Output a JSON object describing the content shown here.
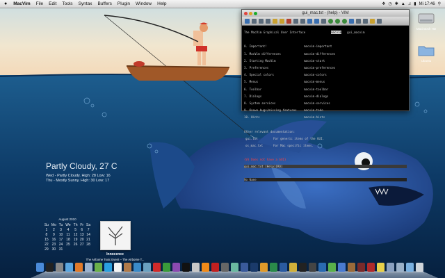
{
  "menubar": {
    "apple": "",
    "app_name": "MacVim",
    "items": [
      "File",
      "Edit",
      "Tools",
      "Syntax",
      "Buffers",
      "Plugin",
      "Window",
      "Help"
    ],
    "clock": "Mi 17:46"
  },
  "vim": {
    "title": "gui_mac.txt - (help) - VIM",
    "header_left": "The MacVim Graphical User Interface",
    "header_tag": "macvim",
    "header_right": "gui_macvim",
    "toc": [
      {
        "left": "0. Important!",
        "right": "macvim-important"
      },
      {
        "left": "1. MacVim differences",
        "right": "macvim-differences"
      },
      {
        "left": "2. Starting MacVim",
        "right": "macvim-start"
      },
      {
        "left": "3. Preferences",
        "right": "macvim-preferences"
      },
      {
        "left": "4. Special colors",
        "right": "macvim-colors"
      },
      {
        "left": "5. Menus",
        "right": "macvim-menus"
      },
      {
        "left": "6. Toolbar",
        "right": "macvim-toolbar"
      },
      {
        "left": "7. Dialogs",
        "right": "macvim-dialogs"
      },
      {
        "left": "8. System services",
        "right": "macvim-services"
      },
      {
        "left": "9. Known bugs/missing features",
        "right": "macvim-todo"
      },
      {
        "left": "10. Hints",
        "right": "macvim-hints"
      }
    ],
    "other_heading": "Other relevant documentation:",
    "docs": [
      {
        "left": "gui.txt",
        "right": "For generic items of the GUI."
      },
      {
        "left": "os_mac.txt",
        "right": "For Mac specific items."
      }
    ],
    "error_line": "{V} Does not have a GUI}",
    "status_line": "gui_mac.txt [Help][RO]",
    "status_line2": "No Name"
  },
  "desktop_icons": [
    {
      "name": "harddisk-icon",
      "label": "Macintosh HD"
    },
    {
      "name": "folder-icon",
      "label": "Ubuntu"
    }
  ],
  "weather": {
    "current": "Partly Cloudy, 27 C",
    "forecast": [
      "Wed - Partly Cloudy. High: 28 Low: 16",
      "Thu - Mostly Sunny. High: 30 Low: 17"
    ]
  },
  "calendar": {
    "month": "August 2010",
    "weekdays": [
      "Su",
      "Mo",
      "Tu",
      "We",
      "Th",
      "Fr",
      "Sa"
    ],
    "weeks": [
      [
        "1",
        "2",
        "3",
        "4",
        "5",
        "6",
        "7"
      ],
      [
        "8",
        "9",
        "10",
        "11",
        "12",
        "13",
        "14"
      ],
      [
        "15",
        "16",
        "17",
        "18",
        "19",
        "20",
        "21"
      ],
      [
        "22",
        "23",
        "24",
        "25",
        "26",
        "27",
        "28"
      ],
      [
        "29",
        "30",
        "31",
        "",
        "",
        "",
        ""
      ]
    ]
  },
  "itunes": {
    "track": "Innocence",
    "artist_album": "The Airborne Toxic Event – The Airborne T..."
  },
  "colors": {
    "sea": "#0d3a66",
    "sky": "#f3e6c8"
  }
}
